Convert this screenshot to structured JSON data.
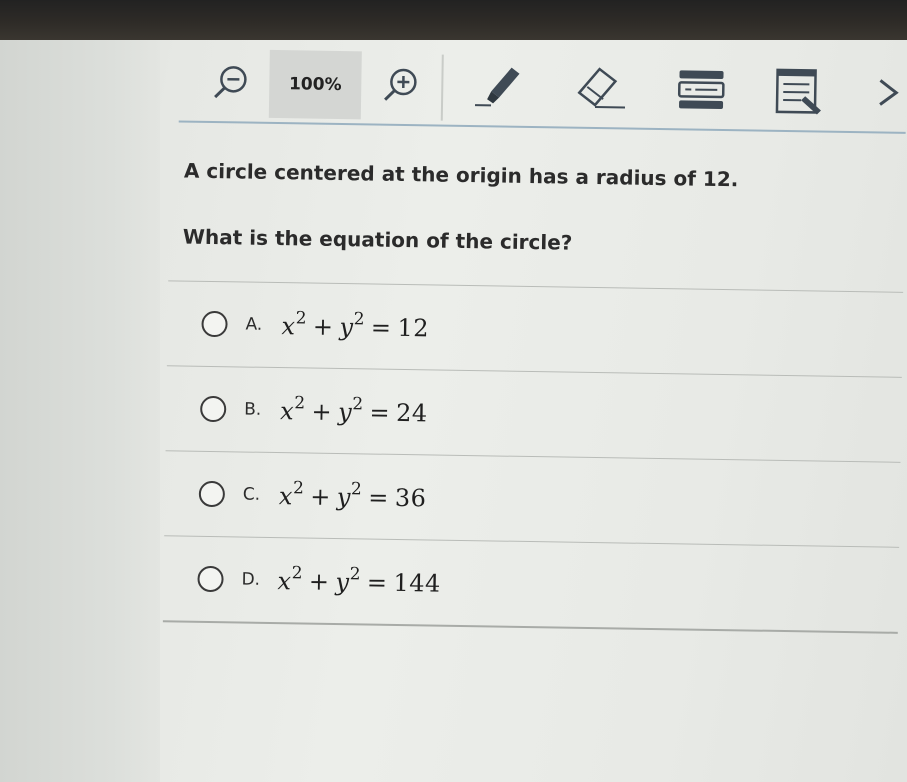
{
  "toolbar": {
    "zoom_label": "100%",
    "tools": [
      {
        "name": "zoom-out-icon"
      },
      {
        "name": "zoom-in-icon"
      },
      {
        "name": "highlighter-icon"
      },
      {
        "name": "eraser-icon"
      },
      {
        "name": "line-reader-icon"
      },
      {
        "name": "notepad-icon"
      },
      {
        "name": "chevron-right-icon"
      }
    ]
  },
  "question": {
    "stem": "A circle centered at the origin has a radius of 12.",
    "prompt": "What is the equation of the circle?"
  },
  "options": [
    {
      "letter": "A.",
      "x": "x",
      "y": "y",
      "exp_x": "2",
      "exp_y": "2",
      "plus": "+",
      "eq": "=",
      "rhs": "12"
    },
    {
      "letter": "B.",
      "x": "x",
      "y": "y",
      "exp_x": "2",
      "exp_y": "2",
      "plus": "+",
      "eq": "=",
      "rhs": "24"
    },
    {
      "letter": "C.",
      "x": "x",
      "y": "y",
      "exp_x": "2",
      "exp_y": "2",
      "plus": "+",
      "eq": "=",
      "rhs": "36"
    },
    {
      "letter": "D.",
      "x": "x",
      "y": "y",
      "exp_x": "2",
      "exp_y": "2",
      "plus": "+",
      "eq": "=",
      "rhs": "144"
    }
  ],
  "colors": {
    "toolbar_underline": "#9cb3c2",
    "icon_stroke": "#3f4a55",
    "text": "#2b2b2b"
  }
}
